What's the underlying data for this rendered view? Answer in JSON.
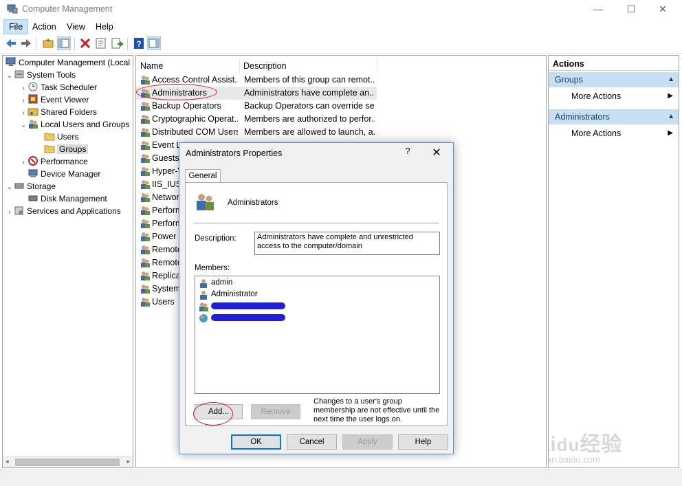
{
  "window": {
    "title": "Computer Management",
    "controls": [
      "—",
      "☐",
      "✕"
    ]
  },
  "menu": [
    "File",
    "Action",
    "View",
    "Help"
  ],
  "tree": {
    "root": "Computer Management (Local",
    "system_tools": "System Tools",
    "task_scheduler": "Task Scheduler",
    "event_viewer": "Event Viewer",
    "shared_folders": "Shared Folders",
    "local_users_groups": "Local Users and Groups",
    "users": "Users",
    "groups": "Groups",
    "performance": "Performance",
    "device_manager": "Device Manager",
    "storage": "Storage",
    "disk_management": "Disk Management",
    "services_apps": "Services and Applications"
  },
  "list": {
    "columns": [
      "Name",
      "Description"
    ],
    "rows": [
      {
        "name": "Access Control Assist...",
        "desc": "Members of this group can remot..."
      },
      {
        "name": "Administrators",
        "desc": "Administrators have complete an..."
      },
      {
        "name": "Backup Operators",
        "desc": "Backup Operators can override se..."
      },
      {
        "name": "Cryptographic Operat...",
        "desc": "Members are authorized to perfor..."
      },
      {
        "name": "Distributed COM Users",
        "desc": "Members are allowed to launch, a..."
      },
      {
        "name": "Event Lo",
        "desc": ""
      },
      {
        "name": "Guests",
        "desc": ""
      },
      {
        "name": "Hyper-V",
        "desc": ""
      },
      {
        "name": "IIS_IUSR",
        "desc": ""
      },
      {
        "name": "Networ",
        "desc": ""
      },
      {
        "name": "Perform",
        "desc": ""
      },
      {
        "name": "Perform",
        "desc": ""
      },
      {
        "name": "Power U",
        "desc": ""
      },
      {
        "name": "Remote",
        "desc": ""
      },
      {
        "name": "Remote",
        "desc": ""
      },
      {
        "name": "Replicat",
        "desc": ""
      },
      {
        "name": "System",
        "desc": ""
      },
      {
        "name": "Users",
        "desc": ""
      }
    ]
  },
  "actions": {
    "header": "Actions",
    "section1": "Groups",
    "section1_item": "More Actions",
    "section2": "Administrators",
    "section2_item": "More Actions"
  },
  "dialog": {
    "title": "Administrators Properties",
    "help": "?",
    "close": "✕",
    "tab": "General",
    "group_name": "Administrators",
    "description_label": "Description:",
    "description_value": "Administrators have complete and unrestricted access to the computer/domain",
    "members_label": "Members:",
    "members": [
      "admin",
      "Administrator"
    ],
    "add": "Add...",
    "remove": "Remove",
    "note": "Changes to a user's group membership are not effective until the next time the user logs on.",
    "ok": "OK",
    "cancel": "Cancel",
    "apply": "Apply",
    "help_button": "Help"
  },
  "watermark": {
    "logo": "Baidu经验",
    "url": "jingyan.baidu.com"
  },
  "colors": {
    "accent": "#0078d7",
    "section_bg": "#c7dff2",
    "annotation": "#e01010",
    "redaction": "#1f1fdc"
  }
}
